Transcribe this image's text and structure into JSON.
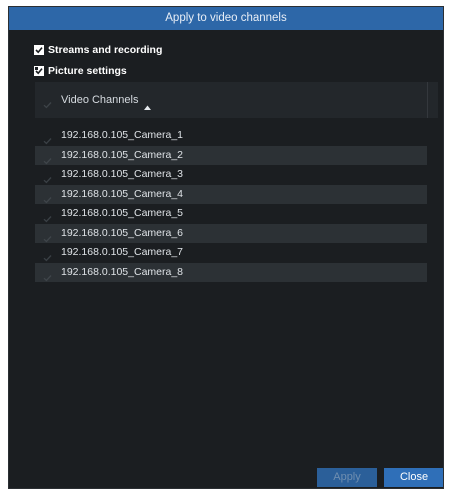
{
  "dialog": {
    "title": "Apply to video channels"
  },
  "options": {
    "streams_label": "Streams and recording",
    "picture_label": "Picture settings"
  },
  "table": {
    "column_header": "Video Channels",
    "rows": [
      "192.168.0.105_Camera_1",
      "192.168.0.105_Camera_2",
      "192.168.0.105_Camera_3",
      "192.168.0.105_Camera_4",
      "192.168.0.105_Camera_5",
      "192.168.0.105_Camera_6",
      "192.168.0.105_Camera_7",
      "192.168.0.105_Camera_8"
    ]
  },
  "buttons": {
    "apply_label": "Apply",
    "close_label": "Close"
  },
  "colors": {
    "titlebar": "#2d67a8",
    "background": "#1b1e21",
    "row_alt": "#2c3135",
    "close_button": "#2f6fb8"
  }
}
